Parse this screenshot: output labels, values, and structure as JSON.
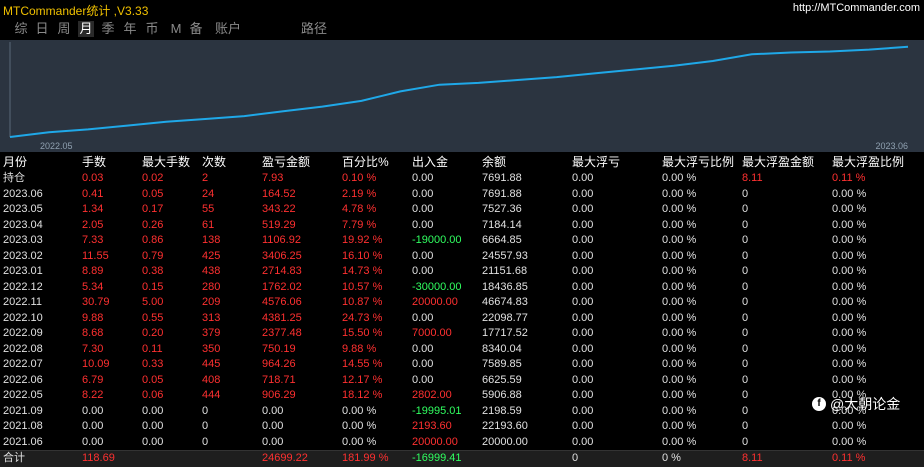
{
  "app": {
    "title": "MTCommander统计 ,V3.33",
    "link": "http://MTCommander.com"
  },
  "tabs": [
    {
      "label": "综",
      "active": false
    },
    {
      "label": "日",
      "active": false
    },
    {
      "label": "周",
      "active": false
    },
    {
      "label": "月",
      "active": true
    },
    {
      "label": "季",
      "active": false
    },
    {
      "label": "年",
      "active": false
    },
    {
      "label": "币",
      "active": false
    },
    {
      "label": "M",
      "active": false
    },
    {
      "label": "备",
      "active": false
    },
    {
      "label": "账户",
      "active": false
    },
    {
      "label": "路径",
      "active": false
    }
  ],
  "chart_data": {
    "type": "line",
    "x_labels": [
      "2022.05",
      "2023.06"
    ],
    "values": [
      0,
      5,
      8,
      12,
      16,
      19,
      22,
      27,
      32,
      38,
      48,
      55,
      57,
      60,
      63,
      67,
      71,
      75,
      80,
      87,
      89,
      90,
      92,
      95
    ],
    "ylim": [
      0,
      100
    ],
    "grid": false,
    "line_color": "#1fa8e8"
  },
  "table": {
    "headers": [
      "月份",
      "手数",
      "最大手数",
      "次数",
      "盈亏金额",
      "百分比%",
      "出入金",
      "余额",
      "最大浮亏",
      "最大浮亏比例",
      "最大浮盈金额",
      "最大浮盈比例"
    ],
    "rows": [
      {
        "cells": [
          "持仓",
          "0.03",
          "0.02",
          "2",
          "7.93",
          "0.10 %",
          "0.00",
          "7691.88",
          "0.00",
          "0.00 %",
          "8.11",
          "0.11 %"
        ],
        "colors": [
          "white",
          "red",
          "red",
          "red",
          "red",
          "red",
          "white",
          "white",
          "white",
          "white",
          "red",
          "red"
        ]
      },
      {
        "cells": [
          "2023.06",
          "0.41",
          "0.05",
          "24",
          "164.52",
          "2.19 %",
          "0.00",
          "7691.88",
          "0.00",
          "0.00 %",
          "0",
          "0.00 %"
        ],
        "colors": [
          "white",
          "red",
          "red",
          "red",
          "red",
          "red",
          "white",
          "white",
          "white",
          "white",
          "white",
          "white"
        ]
      },
      {
        "cells": [
          "2023.05",
          "1.34",
          "0.17",
          "55",
          "343.22",
          "4.78 %",
          "0.00",
          "7527.36",
          "0.00",
          "0.00 %",
          "0",
          "0.00 %"
        ],
        "colors": [
          "white",
          "red",
          "red",
          "red",
          "red",
          "red",
          "white",
          "white",
          "white",
          "white",
          "white",
          "white"
        ]
      },
      {
        "cells": [
          "2023.04",
          "2.05",
          "0.26",
          "61",
          "519.29",
          "7.79 %",
          "0.00",
          "7184.14",
          "0.00",
          "0.00 %",
          "0",
          "0.00 %"
        ],
        "colors": [
          "white",
          "red",
          "red",
          "red",
          "red",
          "red",
          "white",
          "white",
          "white",
          "white",
          "white",
          "white"
        ]
      },
      {
        "cells": [
          "2023.03",
          "7.33",
          "0.86",
          "138",
          "1106.92",
          "19.92 %",
          "-19000.00",
          "6664.85",
          "0.00",
          "0.00 %",
          "0",
          "0.00 %"
        ],
        "colors": [
          "white",
          "red",
          "red",
          "red",
          "red",
          "red",
          "green",
          "white",
          "white",
          "white",
          "white",
          "white"
        ]
      },
      {
        "cells": [
          "2023.02",
          "11.55",
          "0.79",
          "425",
          "3406.25",
          "16.10 %",
          "0.00",
          "24557.93",
          "0.00",
          "0.00 %",
          "0",
          "0.00 %"
        ],
        "colors": [
          "white",
          "red",
          "red",
          "red",
          "red",
          "red",
          "white",
          "white",
          "white",
          "white",
          "white",
          "white"
        ]
      },
      {
        "cells": [
          "2023.01",
          "8.89",
          "0.38",
          "438",
          "2714.83",
          "14.73 %",
          "0.00",
          "21151.68",
          "0.00",
          "0.00 %",
          "0",
          "0.00 %"
        ],
        "colors": [
          "white",
          "red",
          "red",
          "red",
          "red",
          "red",
          "white",
          "white",
          "white",
          "white",
          "white",
          "white"
        ]
      },
      {
        "cells": [
          "2022.12",
          "5.34",
          "0.15",
          "280",
          "1762.02",
          "10.57 %",
          "-30000.00",
          "18436.85",
          "0.00",
          "0.00 %",
          "0",
          "0.00 %"
        ],
        "colors": [
          "white",
          "red",
          "red",
          "red",
          "red",
          "red",
          "green",
          "white",
          "white",
          "white",
          "white",
          "white"
        ]
      },
      {
        "cells": [
          "2022.11",
          "30.79",
          "5.00",
          "209",
          "4576.06",
          "10.87 %",
          "20000.00",
          "46674.83",
          "0.00",
          "0.00 %",
          "0",
          "0.00 %"
        ],
        "colors": [
          "white",
          "red",
          "red",
          "red",
          "red",
          "red",
          "red",
          "white",
          "white",
          "white",
          "white",
          "white"
        ]
      },
      {
        "cells": [
          "2022.10",
          "9.88",
          "0.55",
          "313",
          "4381.25",
          "24.73 %",
          "0.00",
          "22098.77",
          "0.00",
          "0.00 %",
          "0",
          "0.00 %"
        ],
        "colors": [
          "white",
          "red",
          "red",
          "red",
          "red",
          "red",
          "white",
          "white",
          "white",
          "white",
          "white",
          "white"
        ]
      },
      {
        "cells": [
          "2022.09",
          "8.68",
          "0.20",
          "379",
          "2377.48",
          "15.50 %",
          "7000.00",
          "17717.52",
          "0.00",
          "0.00 %",
          "0",
          "0.00 %"
        ],
        "colors": [
          "white",
          "red",
          "red",
          "red",
          "red",
          "red",
          "red",
          "white",
          "white",
          "white",
          "white",
          "white"
        ]
      },
      {
        "cells": [
          "2022.08",
          "7.30",
          "0.11",
          "350",
          "750.19",
          "9.88 %",
          "0.00",
          "8340.04",
          "0.00",
          "0.00 %",
          "0",
          "0.00 %"
        ],
        "colors": [
          "white",
          "red",
          "red",
          "red",
          "red",
          "red",
          "white",
          "white",
          "white",
          "white",
          "white",
          "white"
        ]
      },
      {
        "cells": [
          "2022.07",
          "10.09",
          "0.33",
          "445",
          "964.26",
          "14.55 %",
          "0.00",
          "7589.85",
          "0.00",
          "0.00 %",
          "0",
          "0.00 %"
        ],
        "colors": [
          "white",
          "red",
          "red",
          "red",
          "red",
          "red",
          "white",
          "white",
          "white",
          "white",
          "white",
          "white"
        ]
      },
      {
        "cells": [
          "2022.06",
          "6.79",
          "0.05",
          "408",
          "718.71",
          "12.17 %",
          "0.00",
          "6625.59",
          "0.00",
          "0.00 %",
          "0",
          "0.00 %"
        ],
        "colors": [
          "white",
          "red",
          "red",
          "red",
          "red",
          "red",
          "white",
          "white",
          "white",
          "white",
          "white",
          "white"
        ]
      },
      {
        "cells": [
          "2022.05",
          "8.22",
          "0.06",
          "444",
          "906.29",
          "18.12 %",
          "2802.00",
          "5906.88",
          "0.00",
          "0.00 %",
          "0",
          "0.00 %"
        ],
        "colors": [
          "white",
          "red",
          "red",
          "red",
          "red",
          "red",
          "red",
          "white",
          "white",
          "white",
          "white",
          "white"
        ]
      },
      {
        "cells": [
          "2021.09",
          "0.00",
          "0.00",
          "0",
          "0.00",
          "0.00 %",
          "-19995.01",
          "2198.59",
          "0.00",
          "0.00 %",
          "0",
          "0.00 %"
        ],
        "colors": [
          "white",
          "white",
          "white",
          "white",
          "white",
          "white",
          "green",
          "white",
          "white",
          "white",
          "white",
          "white"
        ]
      },
      {
        "cells": [
          "2021.08",
          "0.00",
          "0.00",
          "0",
          "0.00",
          "0.00 %",
          "2193.60",
          "22193.60",
          "0.00",
          "0.00 %",
          "0",
          "0.00 %"
        ],
        "colors": [
          "white",
          "white",
          "white",
          "white",
          "white",
          "white",
          "red",
          "white",
          "white",
          "white",
          "white",
          "white"
        ]
      },
      {
        "cells": [
          "2021.06",
          "0.00",
          "0.00",
          "0",
          "0.00",
          "0.00 %",
          "20000.00",
          "20000.00",
          "0.00",
          "0.00 %",
          "0",
          "0.00 %"
        ],
        "colors": [
          "white",
          "white",
          "white",
          "white",
          "white",
          "white",
          "red",
          "white",
          "white",
          "white",
          "white",
          "white"
        ]
      }
    ],
    "total": {
      "cells": [
        "合计",
        "118.69",
        "",
        "",
        "24699.22",
        "181.99 %",
        "-16999.41",
        "",
        "0",
        "0 %",
        "8.11",
        "0.11 %"
      ],
      "colors": [
        "white",
        "red",
        "white",
        "white",
        "red",
        "red",
        "green",
        "white",
        "white",
        "white",
        "red",
        "red"
      ]
    }
  },
  "watermark": {
    "icon": "f",
    "text": "@大朝论金"
  },
  "colors": {
    "red": "#ff3030",
    "green": "#30ff60",
    "white": "#e0e0e0",
    "chart_bg": "#2b3440",
    "title": "#f0c000"
  }
}
